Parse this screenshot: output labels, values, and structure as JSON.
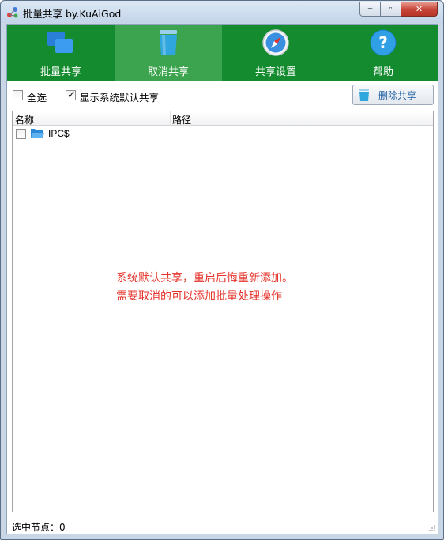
{
  "window": {
    "title": "批量共享 by.KuAiGod",
    "controls": {
      "minimize": "–",
      "maximize": "▫",
      "close": "✕"
    }
  },
  "toolbar": {
    "items": [
      {
        "label": "批量共享",
        "icon": "share-folders-icon"
      },
      {
        "label": "取消共享",
        "icon": "recycle-bin-icon",
        "active": true
      },
      {
        "label": "共享设置",
        "icon": "compass-icon"
      },
      {
        "label": "帮助",
        "icon": "help-icon"
      }
    ],
    "background": "#138b2e",
    "active_background": "#3ca44e"
  },
  "options": {
    "select_all": {
      "label": "全选",
      "checked": false
    },
    "show_default": {
      "label": "显示系统默认共享",
      "checked": true
    },
    "delete_button": "删除共享"
  },
  "list": {
    "columns": [
      "名称",
      "路径"
    ],
    "rows": [
      {
        "name": "IPC$",
        "path": "",
        "checked": false
      }
    ]
  },
  "notice": {
    "line1": "系统默认共享，重启后悔重新添加。",
    "line2": "需要取消的可以添加批量处理操作",
    "color": "#e5342c"
  },
  "status": {
    "selected_nodes": "选中节点：0"
  }
}
